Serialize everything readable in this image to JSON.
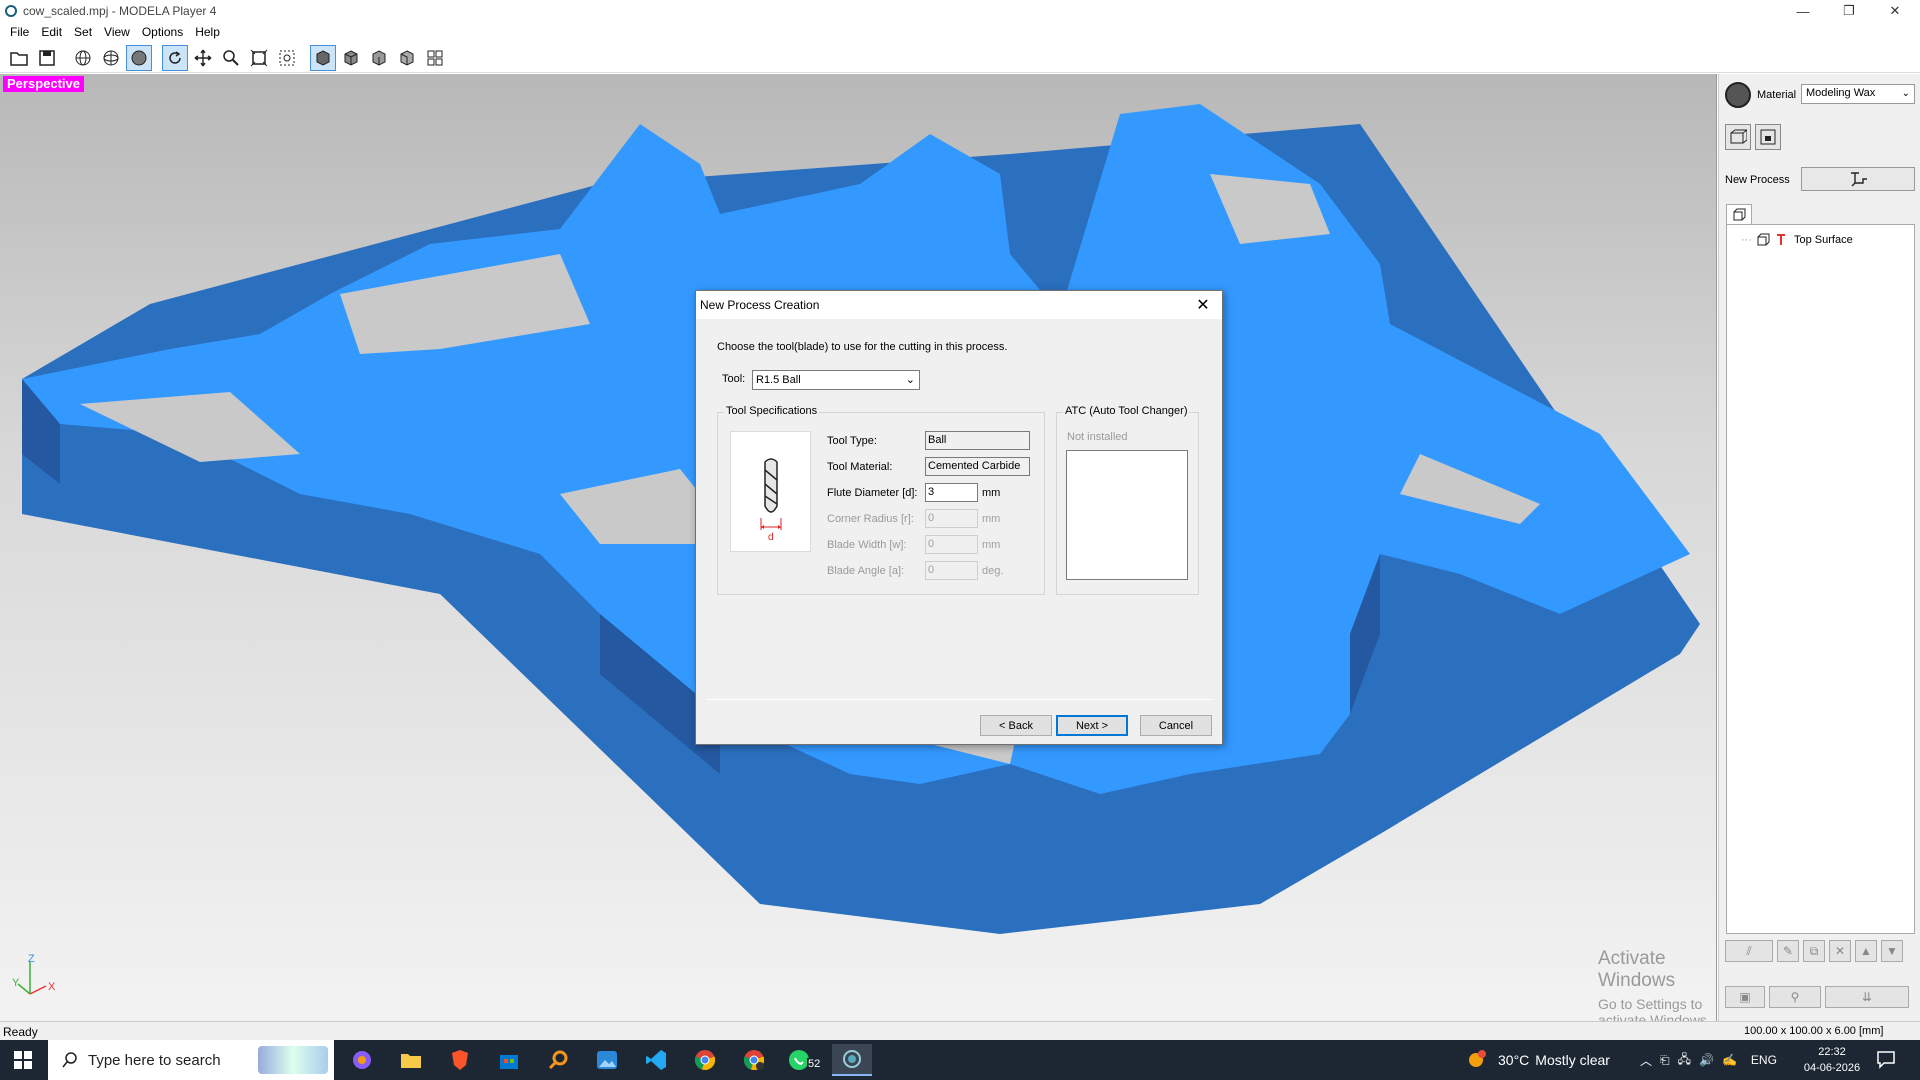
{
  "window": {
    "title": "cow_scaled.mpj - MODELA Player 4",
    "minimize": "—",
    "restore": "❐",
    "close": "✕"
  },
  "menu": [
    "File",
    "Edit",
    "Set",
    "View",
    "Options",
    "Help"
  ],
  "toolbar": {
    "buttons": [
      "open-folder-icon",
      "save-icon",
      "wireframe-globe-icon",
      "grid-globe-icon",
      "shaded-sphere-icon",
      "rotate-icon",
      "pan-icon",
      "zoom-icon",
      "fit-view-icon",
      "zoom-window-icon",
      "iso-view-icon",
      "front-view-icon",
      "side-view-icon",
      "back-view-icon",
      "multi-view-icon"
    ]
  },
  "viewport": {
    "label": "Perspective",
    "model_color": "#3399ff",
    "axis_z": "Z",
    "axis_y": "Y",
    "axis_x": "X"
  },
  "watermark": {
    "line1": "Activate Windows",
    "line2": "Go to Settings to activate Windows."
  },
  "right_panel": {
    "material_label": "Material",
    "material_value": "Modeling Wax",
    "new_process_label": "New Process",
    "tree_item": "Top Surface"
  },
  "dialog": {
    "title": "New Process Creation",
    "instruction": "Choose the tool(blade) to use for the cutting in this process.",
    "tool_label": "Tool:",
    "tool_value": "R1.5 Ball",
    "spec_group": "Tool Specifications",
    "tool_type_label": "Tool Type:",
    "tool_type_value": "Ball",
    "tool_material_label": "Tool Material:",
    "tool_material_value": "Cemented Carbide",
    "flute_diameter_label": "Flute Diameter [d]:",
    "flute_diameter_value": "3",
    "corner_radius_label": "Corner Radius [r]:",
    "corner_radius_value": "0",
    "blade_width_label": "Blade Width [w]:",
    "blade_width_value": "0",
    "blade_angle_label": "Blade Angle [a]:",
    "blade_angle_value": "0",
    "unit_mm": "mm",
    "unit_deg": "deg.",
    "diagram_letter": "d",
    "atc_group": "ATC (Auto Tool Changer)",
    "atc_status": "Not installed",
    "back_button": "< Back",
    "next_button": "Next >",
    "cancel_button": "Cancel"
  },
  "status": {
    "left": "Ready",
    "dimensions": "100.00 x 100.00 x 6.00 [mm]"
  },
  "taskbar": {
    "search_placeholder": "Type here to search",
    "whatsapp_badge": "52",
    "weather_temp": "30°C",
    "weather_desc": "Mostly clear",
    "language": "ENG",
    "time": "22:32",
    "date": "04-06-2026"
  }
}
